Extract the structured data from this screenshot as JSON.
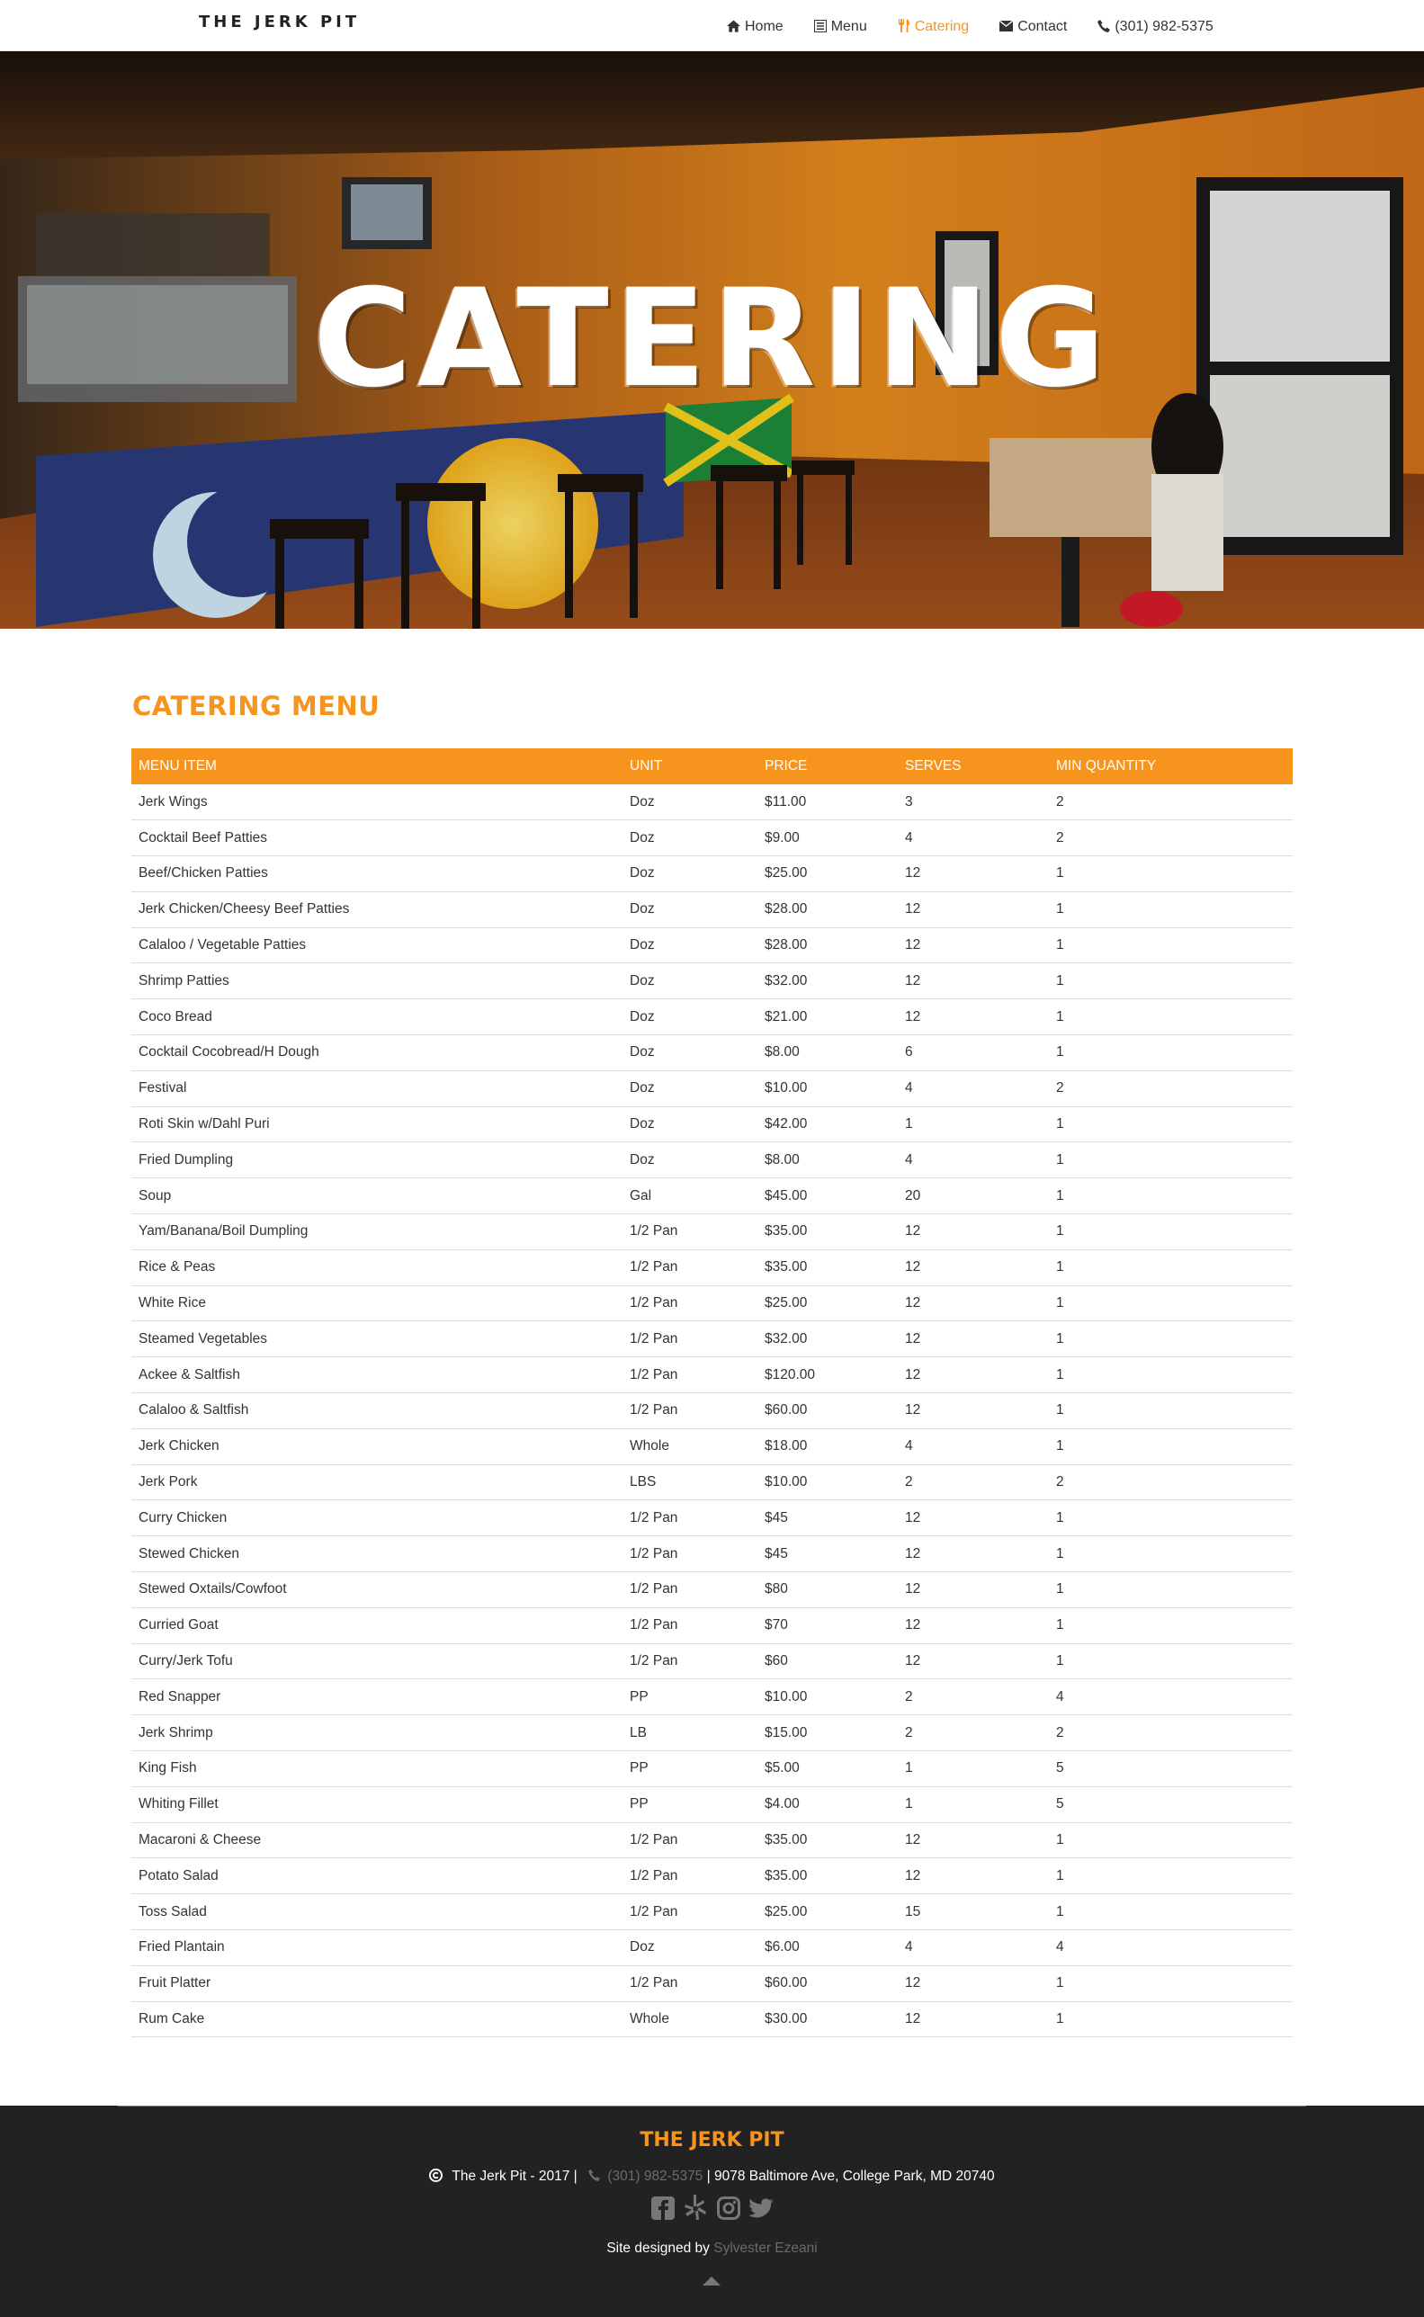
{
  "nav": {
    "brand": "THE JERK PIT",
    "items": [
      {
        "label": "Home",
        "icon": "home-icon",
        "active": false
      },
      {
        "label": "Menu",
        "icon": "list-icon",
        "active": false
      },
      {
        "label": "Catering",
        "icon": "cutlery-icon",
        "active": true
      },
      {
        "label": "Contact",
        "icon": "envelope-icon",
        "active": false
      },
      {
        "label": "(301) 982-5375",
        "icon": "phone-icon",
        "active": false
      }
    ]
  },
  "hero": {
    "title": "CATERING"
  },
  "menu": {
    "title": "CATERING MENU",
    "columns": [
      "MENU ITEM",
      "UNIT",
      "PRICE",
      "SERVES",
      "MIN QUANTITY"
    ],
    "rows": [
      [
        "Jerk Wings",
        "Doz",
        "$11.00",
        "3",
        "2"
      ],
      [
        "Cocktail Beef Patties",
        "Doz",
        "$9.00",
        "4",
        "2"
      ],
      [
        "Beef/Chicken Patties",
        "Doz",
        "$25.00",
        "12",
        "1"
      ],
      [
        "Jerk Chicken/Cheesy Beef Patties",
        "Doz",
        "$28.00",
        "12",
        "1"
      ],
      [
        "Calaloo / Vegetable Patties",
        "Doz",
        "$28.00",
        "12",
        "1"
      ],
      [
        "Shrimp Patties",
        "Doz",
        "$32.00",
        "12",
        "1"
      ],
      [
        "Coco Bread",
        "Doz",
        "$21.00",
        "12",
        "1"
      ],
      [
        "Cocktail Cocobread/H Dough",
        "Doz",
        "$8.00",
        "6",
        "1"
      ],
      [
        "Festival",
        "Doz",
        "$10.00",
        "4",
        "2"
      ],
      [
        "Roti Skin w/Dahl Puri",
        "Doz",
        "$42.00",
        "1",
        "1"
      ],
      [
        "Fried Dumpling",
        "Doz",
        "$8.00",
        "4",
        "1"
      ],
      [
        "Soup",
        "Gal",
        "$45.00",
        "20",
        "1"
      ],
      [
        "Yam/Banana/Boil Dumpling",
        "1/2 Pan",
        "$35.00",
        "12",
        "1"
      ],
      [
        "Rice & Peas",
        "1/2 Pan",
        "$35.00",
        "12",
        "1"
      ],
      [
        "White Rice",
        "1/2 Pan",
        "$25.00",
        "12",
        "1"
      ],
      [
        "Steamed Vegetables",
        "1/2 Pan",
        "$32.00",
        "12",
        "1"
      ],
      [
        "Ackee & Saltfish",
        "1/2 Pan",
        "$120.00",
        "12",
        "1"
      ],
      [
        "Calaloo & Saltfish",
        "1/2 Pan",
        "$60.00",
        "12",
        "1"
      ],
      [
        "Jerk Chicken",
        "Whole",
        "$18.00",
        "4",
        "1"
      ],
      [
        "Jerk Pork",
        "LBS",
        "$10.00",
        "2",
        "2"
      ],
      [
        "Curry Chicken",
        "1/2 Pan",
        "$45",
        "12",
        "1"
      ],
      [
        "Stewed Chicken",
        "1/2 Pan",
        "$45",
        "12",
        "1"
      ],
      [
        "Stewed Oxtails/Cowfoot",
        "1/2 Pan",
        "$80",
        "12",
        "1"
      ],
      [
        "Curried Goat",
        "1/2 Pan",
        "$70",
        "12",
        "1"
      ],
      [
        "Curry/Jerk Tofu",
        "1/2 Pan",
        "$60",
        "12",
        "1"
      ],
      [
        "Red Snapper",
        "PP",
        "$10.00",
        "2",
        "4"
      ],
      [
        "Jerk Shrimp",
        "LB",
        "$15.00",
        "2",
        "2"
      ],
      [
        "King Fish",
        "PP",
        "$5.00",
        "1",
        "5"
      ],
      [
        "Whiting Fillet",
        "PP",
        "$4.00",
        "1",
        "5"
      ],
      [
        "Macaroni & Cheese",
        "1/2 Pan",
        "$35.00",
        "12",
        "1"
      ],
      [
        "Potato Salad",
        "1/2 Pan",
        "$35.00",
        "12",
        "1"
      ],
      [
        "Toss Salad",
        "1/2 Pan",
        "$25.00",
        "15",
        "1"
      ],
      [
        "Fried Plantain",
        "Doz",
        "$6.00",
        "4",
        "4"
      ],
      [
        "Fruit Platter",
        "1/2 Pan",
        "$60.00",
        "12",
        "1"
      ],
      [
        "Rum Cake",
        "Whole",
        "$30.00",
        "12",
        "1"
      ]
    ]
  },
  "footer": {
    "brand": "THE JERK PIT",
    "copyright": "The Jerk Pit - 2017 |",
    "phone": "(301) 982-5375",
    "address": "| 9078 Baltimore Ave, College Park, MD 20740",
    "social": [
      "facebook-icon",
      "yelp-icon",
      "instagram-icon",
      "twitter-icon"
    ],
    "credit_prefix": "Site designed by",
    "credit_name": "Sylvester Ezeani"
  },
  "colors": {
    "accent": "#f7941d",
    "footer_bg": "#222222",
    "text": "#333333"
  }
}
